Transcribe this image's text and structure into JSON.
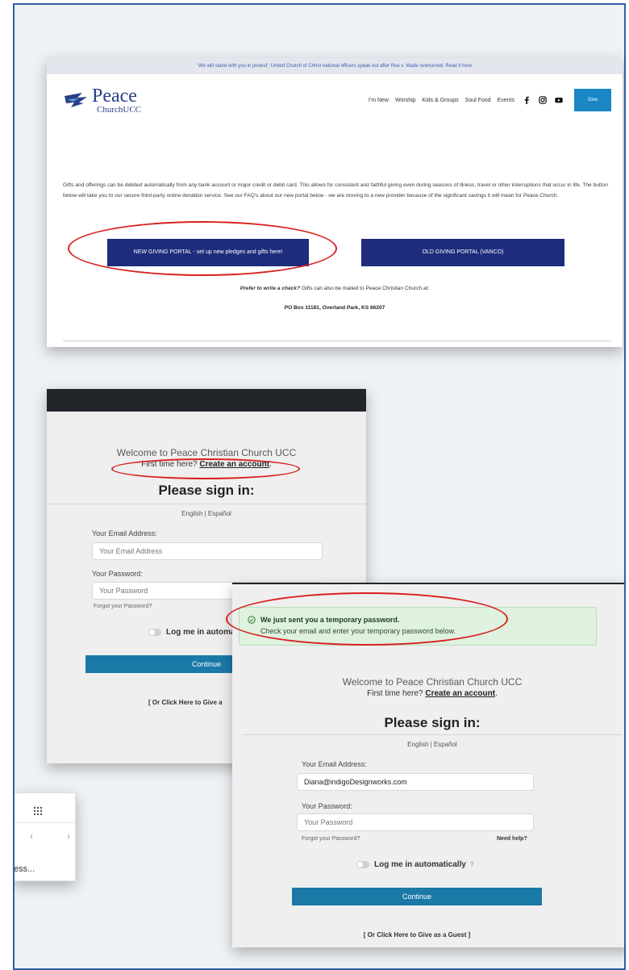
{
  "website": {
    "banner": "'We will stand with you in protest': United Church of Christ national officers speak out after Roe v. Wade overturned. Read it here",
    "logo_main": "Peace",
    "logo_sub": "ChurchUCC",
    "nav": [
      "I'm New",
      "Worship",
      "Kids & Groups",
      "Soul Food",
      "Events"
    ],
    "social_icons": [
      "facebook-icon",
      "instagram-icon",
      "youtube-icon"
    ],
    "give_label": "Give",
    "description": "Gifts and offerings can be debited automatically from any bank account or major credit or debit card. This allows for consistent and faithful giving even during seasons of illness, travel or other interruptions that occur in life. The button below will take you to our secure third-party online donation service. See our FAQ's about our new portal below - we are moving to a new provider because of the significant savings it will mean for Peace Church.",
    "btn_new": "NEW GIVING PORTAL - set up new pledges and gifts here!",
    "btn_old": "OLD GIVING PORTAL (VANCO)",
    "check_bold": "Prefer to write a check?",
    "check_rest": " Gifts can also be mailed to Peace Christian Church at:",
    "address": "PO Box 11181, Overland Park, KS 66207"
  },
  "signin1": {
    "welcome": "Welcome to Peace Christian Church UCC",
    "first_time": "First time here?",
    "create_account": "Create an account",
    "title": "Please sign in:",
    "languages": "English | Español",
    "email_label": "Your Email Address:",
    "email_placeholder": "Your Email Address",
    "password_label": "Your Password:",
    "password_placeholder": "Your Password",
    "forgot": "Forgot your Password?",
    "log_me": "Log me in automa",
    "continue": "Continue",
    "guest": "[ Or Click Here to Give a"
  },
  "signin2": {
    "alert_title": "We just sent you a temporary password.",
    "alert_body": "Check your email and enter your temporary password below.",
    "welcome": "Welcome to Peace Christian Church UCC",
    "first_time": "First time here?",
    "create_account": "Create an account",
    "title": "Please sign in:",
    "languages": "English | Español",
    "email_label": "Your Email Address:",
    "email_value": "Diana@indigoDesignworks.com",
    "password_label": "Your Password:",
    "password_placeholder": "Your Password",
    "forgot": "Forgot your Password?",
    "need_help": "Need help?",
    "log_me": "Log me in automatically",
    "help_glyph": "?",
    "continue": "Continue",
    "guest": "[ Or Click Here to Give as a Guest ]"
  },
  "browser": {
    "address_fragment": "ess...",
    "back_glyph": "‹",
    "forward_glyph": "›"
  },
  "colors": {
    "frame_border": "#2d5fa8",
    "navy_button": "#1d2c7d",
    "give_button": "#1a86c4",
    "continue_button": "#1a79a6",
    "alert_bg": "#def2df",
    "annotation_red": "#d8211f"
  }
}
